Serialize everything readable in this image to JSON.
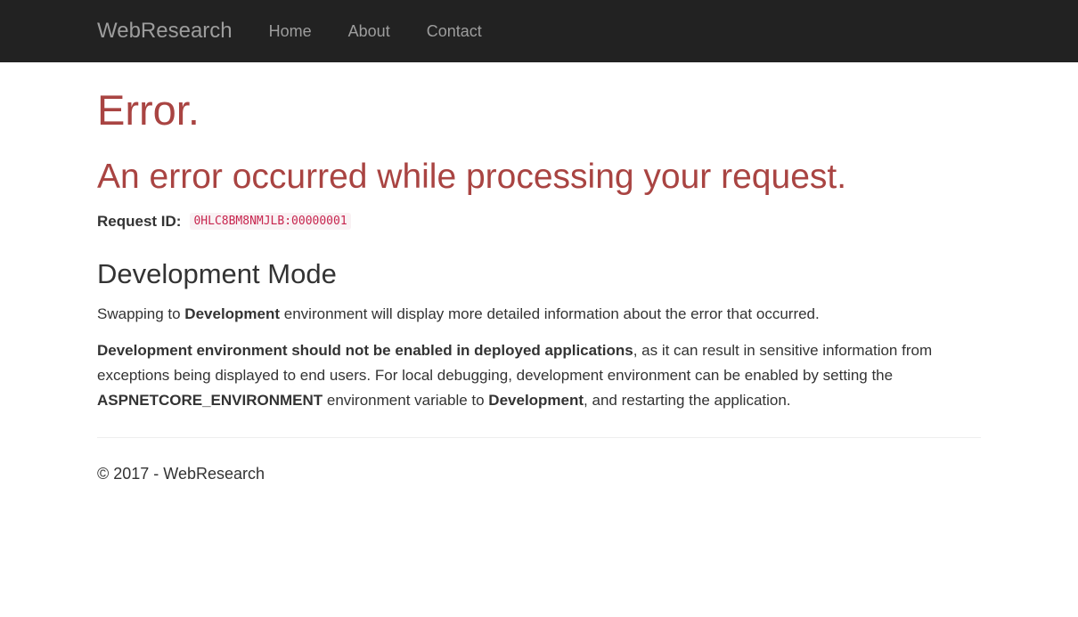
{
  "navbar": {
    "brand": "WebResearch",
    "links": [
      "Home",
      "About",
      "Contact"
    ]
  },
  "error": {
    "title": "Error.",
    "subtitle": "An error occurred while processing your request.",
    "request_id_label": "Request ID:",
    "request_id_value": "0HLC8BM8NMJLB:00000001"
  },
  "dev_mode": {
    "heading": "Development Mode",
    "p1": {
      "t1": "Swapping to ",
      "b1": "Development",
      "t2": " environment will display more detailed information about the error that occurred."
    },
    "p2": {
      "b1": "Development environment should not be enabled in deployed applications",
      "t1": ", as it can result in sensitive information from exceptions being displayed to end users. For local debugging, development environment can be enabled by setting the ",
      "b2": "ASPNETCORE_ENVIRONMENT",
      "t2": " environment variable to ",
      "b3": "Development",
      "t3": ", and restarting the application."
    }
  },
  "footer": {
    "text": "© 2017 - WebResearch"
  },
  "colors": {
    "navbar_bg": "#222222",
    "nav_text": "#9d9d9d",
    "error_red": "#a94442",
    "code_color": "#c7254e",
    "code_bg": "#f9f2f4"
  }
}
